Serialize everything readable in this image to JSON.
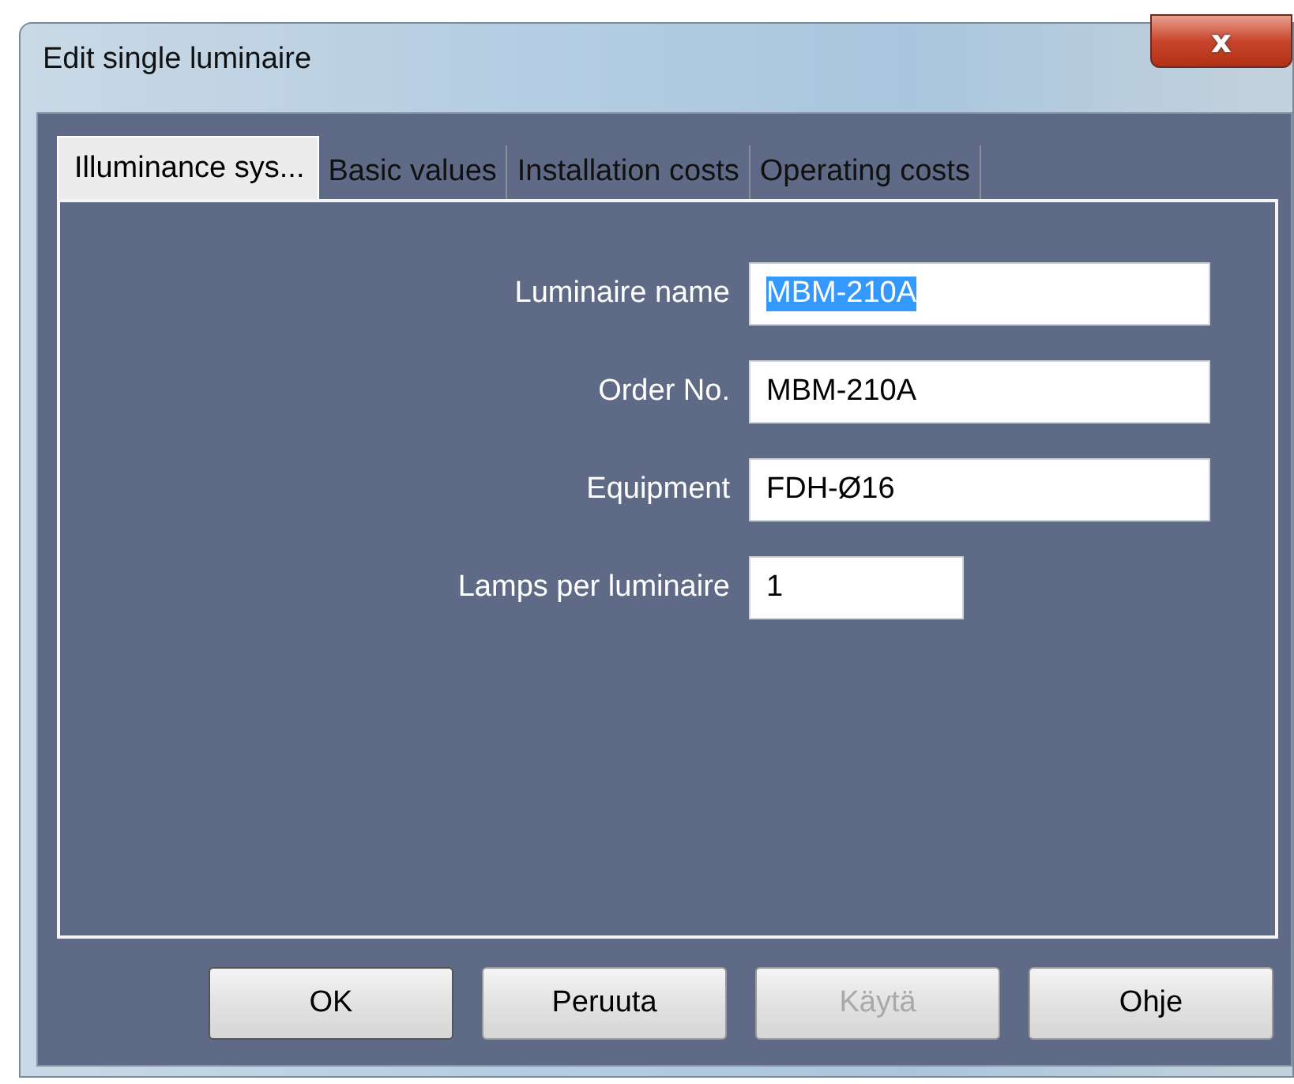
{
  "window": {
    "title": "Edit single luminaire",
    "close": "x"
  },
  "tabs": [
    {
      "label": "Illuminance sys...",
      "selected": true
    },
    {
      "label": "Basic values",
      "selected": false
    },
    {
      "label": "Installation costs",
      "selected": false
    },
    {
      "label": "Operating costs",
      "selected": false
    }
  ],
  "fields": [
    {
      "label": "Luminaire name",
      "value": "MBM-210A",
      "text_selected": true,
      "kind": "wide"
    },
    {
      "label": "Order No.",
      "value": "MBM-210A",
      "text_selected": false,
      "kind": "wide"
    },
    {
      "label": "Equipment",
      "value": "FDH-Ø16",
      "text_selected": false,
      "kind": "wide"
    },
    {
      "label": "Lamps per luminaire",
      "value": "1",
      "text_selected": false,
      "kind": "narrow"
    }
  ],
  "buttons": [
    {
      "label": "OK",
      "disabled": false,
      "default": true
    },
    {
      "label": "Peruuta",
      "disabled": false,
      "default": false
    },
    {
      "label": "Käytä",
      "disabled": true,
      "default": false
    },
    {
      "label": "Ohje",
      "disabled": false,
      "default": false
    }
  ]
}
